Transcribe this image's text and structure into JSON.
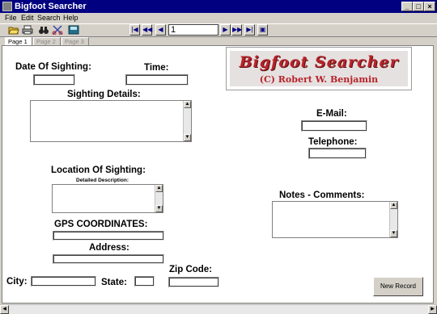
{
  "window": {
    "title": "Bigfoot Searcher"
  },
  "titlebar_buttons": {
    "minimize": "_",
    "maximize": "□",
    "close": "×"
  },
  "menu": {
    "file": "File",
    "edit": "Edit",
    "search": "Search",
    "help": "Help"
  },
  "toolbar": {
    "open_icon": "folder-open-icon",
    "print_icon": "printer-icon",
    "find_icon": "binoculars-icon",
    "cut_icon": "scissors-icon",
    "save_icon": "disk-icon"
  },
  "nav": {
    "first": "|◀",
    "prev_page": "◀◀",
    "prev": "◀",
    "record": "1",
    "next": "▶",
    "next_page": "▶▶",
    "last": "▶|",
    "new": "▣"
  },
  "tabs": [
    "Page 1",
    "Page 2",
    "Page 3"
  ],
  "logo": {
    "title": "Bigfoot Searcher",
    "copyright": "(C) Robert W. Benjamin"
  },
  "labels": {
    "date": "Date Of Sighting:",
    "time": "Time:",
    "details": "Sighting Details:",
    "email": "E-Mail:",
    "telephone": "Telephone:",
    "location": "Location Of Sighting:",
    "location_sub": "Detailed Description:",
    "notes": "Notes - Comments:",
    "gps": "GPS COORDINATES:",
    "address": "Address:",
    "zip": "Zip Code:",
    "city": "City:",
    "state": "State:"
  },
  "buttons": {
    "new_record": "New Record"
  },
  "colors": {
    "titlebar": "#000080",
    "logo_red": "#b8232a",
    "window_bg": "#d4d0c8"
  }
}
